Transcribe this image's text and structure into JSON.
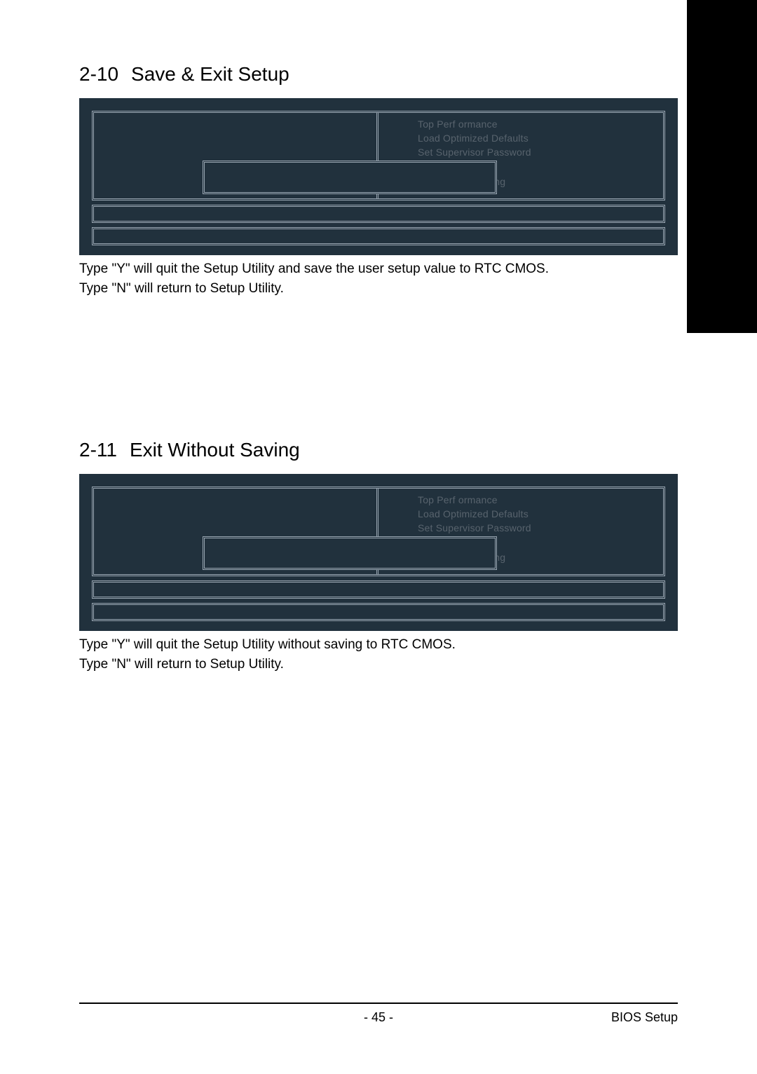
{
  "side_tab_label": "",
  "sections": {
    "save_exit": {
      "heading_num": "2-10",
      "heading_title": "Save & Exit Setup",
      "menu_right": {
        "line1": "Top  Perf ormance",
        "line2": "Load Optimized Defaults",
        "line3": "Set Supervisor Password"
      },
      "exit_label": "Exit Without Saving",
      "desc_line1": "Type \"Y\" will quit the Setup Utility and save the user setup value to RTC CMOS.",
      "desc_line2": "Type \"N\" will return to Setup Utility."
    },
    "exit_without": {
      "heading_num": "2-11",
      "heading_title": "Exit Without Saving",
      "menu_right": {
        "line1": "Top  Perf ormance",
        "line2": "Load Optimized Defaults",
        "line3": "Set Supervisor Password"
      },
      "exit_label": "Exit Without Saving",
      "desc_line1": "Type \"Y\" will quit the Setup Utility without saving to RTC CMOS.",
      "desc_line2": "Type \"N\" will return to Setup Utility."
    }
  },
  "footer": {
    "page_num": "-  45  -",
    "section_label": "BIOS Setup"
  }
}
